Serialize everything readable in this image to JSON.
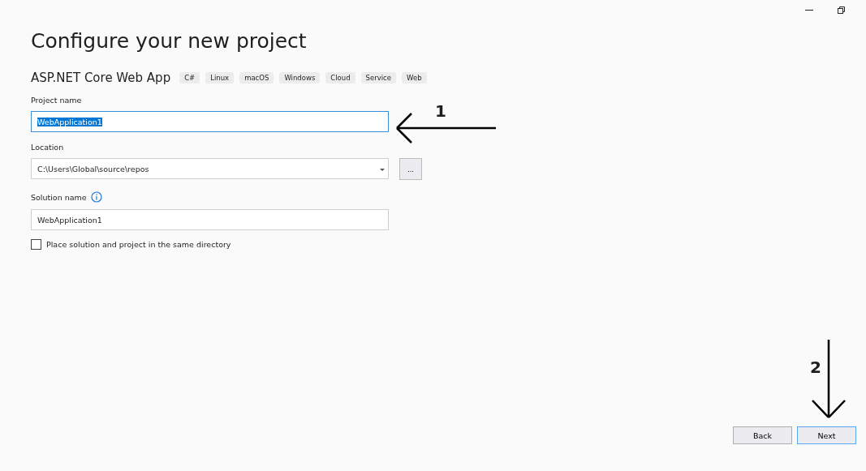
{
  "title": "Configure your new project",
  "template": {
    "name": "ASP.NET Core Web App",
    "tags": [
      "C#",
      "Linux",
      "macOS",
      "Windows",
      "Cloud",
      "Service",
      "Web"
    ]
  },
  "project_name": {
    "label": "Project name",
    "value": "WebApplication1",
    "text_selected": true
  },
  "location": {
    "label": "Location",
    "value": "C:\\Users\\Global\\source\\repos",
    "browse": "..."
  },
  "solution_name": {
    "label": "Solution name",
    "value": "WebApplication1"
  },
  "same_directory": {
    "label": "Place solution and project in the same directory",
    "checked": false
  },
  "buttons": [
    {
      "label": "Back",
      "is_default": false
    },
    {
      "label": "Next",
      "is_default": true
    }
  ],
  "annotations": [
    {
      "kind": "left",
      "label": "1"
    },
    {
      "kind": "down",
      "label": "2"
    }
  ]
}
